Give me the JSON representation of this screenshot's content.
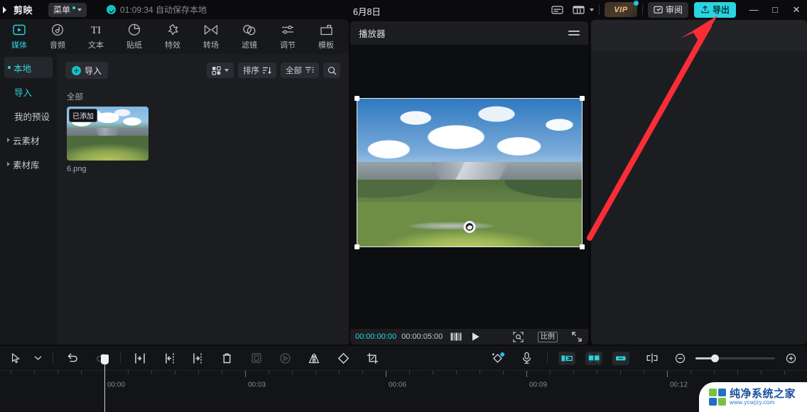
{
  "app": {
    "title": "剪映",
    "menu_label": "菜单",
    "autosave_text": "01:09:34 自动保存本地",
    "project_date": "6月8日"
  },
  "titlebar": {
    "icons": [
      {
        "name": "subtitle-icon",
        "glyph": "subtitle"
      },
      {
        "name": "layout-icon",
        "glyph": "layout"
      }
    ],
    "vip_label": "VIP",
    "review_label": "审阅",
    "export_label": "导出",
    "window_controls": [
      {
        "name": "minimize-button",
        "glyph": "—"
      },
      {
        "name": "maximize-button",
        "glyph": "□"
      },
      {
        "name": "close-button",
        "glyph": "✕"
      }
    ]
  },
  "tool_tabs": [
    {
      "label": "媒体",
      "icon": "media-icon",
      "active": true
    },
    {
      "label": "音频",
      "icon": "audio-icon",
      "active": false
    },
    {
      "label": "文本",
      "icon": "text-icon",
      "active": false
    },
    {
      "label": "贴纸",
      "icon": "sticker-icon",
      "active": false
    },
    {
      "label": "特效",
      "icon": "effects-icon",
      "active": false
    },
    {
      "label": "转场",
      "icon": "transition-icon",
      "active": false
    },
    {
      "label": "滤镜",
      "icon": "filter-icon",
      "active": false
    },
    {
      "label": "调节",
      "icon": "adjust-icon",
      "active": false
    },
    {
      "label": "模板",
      "icon": "template-icon",
      "active": false
    }
  ],
  "sidebar": {
    "items": [
      {
        "label": "本地",
        "state": "selected"
      },
      {
        "label": "导入",
        "state": "highlight"
      },
      {
        "label": "我的预设",
        "state": "normal"
      },
      {
        "label": "云素材",
        "state": "collapsed"
      },
      {
        "label": "素材库",
        "state": "collapsed"
      }
    ]
  },
  "media_panel": {
    "import_label": "导入",
    "sort_label": "排序",
    "filter_label": "全部",
    "group_label": "全部",
    "items": [
      {
        "name": "6.png",
        "badge": "已添加"
      }
    ]
  },
  "player": {
    "title": "播放器",
    "current_time": "00:00:00:00",
    "total_time": "00:00:05:00",
    "ratio_label": "比例"
  },
  "timeline": {
    "ruler_labels": [
      "00:00",
      "00:03",
      "00:06",
      "00:09",
      "00:12"
    ],
    "playhead_time": "00:00",
    "zoom_percent": 22,
    "tools": [
      {
        "name": "select-tool-icon",
        "state": "normal"
      },
      {
        "name": "chevron-down-icon",
        "state": "normal"
      },
      {
        "name": "undo-icon",
        "state": "normal"
      },
      {
        "name": "redo-icon",
        "state": "dim"
      },
      {
        "name": "split-icon",
        "state": "normal"
      },
      {
        "name": "trim-left-icon",
        "state": "normal"
      },
      {
        "name": "trim-right-icon",
        "state": "normal"
      },
      {
        "name": "delete-icon",
        "state": "normal"
      },
      {
        "name": "freeze-frame-icon",
        "state": "dim"
      },
      {
        "name": "keyframe-icon",
        "state": "dim"
      },
      {
        "name": "mirror-icon",
        "state": "normal"
      },
      {
        "name": "rotate-icon",
        "state": "normal"
      },
      {
        "name": "crop-icon",
        "state": "normal"
      }
    ],
    "right_tools": [
      {
        "name": "auto-caption-icon",
        "state": "normal"
      },
      {
        "name": "microphone-icon",
        "state": "normal"
      },
      {
        "name": "clip-mode-left-icon",
        "state": "active"
      },
      {
        "name": "clip-mode-center-icon",
        "state": "active"
      },
      {
        "name": "clip-mode-right-icon",
        "state": "active"
      },
      {
        "name": "snap-icon",
        "state": "normal"
      },
      {
        "name": "zoom-out-icon",
        "state": "normal"
      },
      {
        "name": "zoom-in-icon",
        "state": "normal"
      }
    ]
  },
  "annotation": {
    "arrow_color": "#fa2d37"
  },
  "watermark": {
    "title": "纯净系统之家",
    "url": "www.ycwjzy.com",
    "colors": [
      "#7ac143",
      "#1f6fc4",
      "#1f6fc4",
      "#7ac143"
    ]
  }
}
